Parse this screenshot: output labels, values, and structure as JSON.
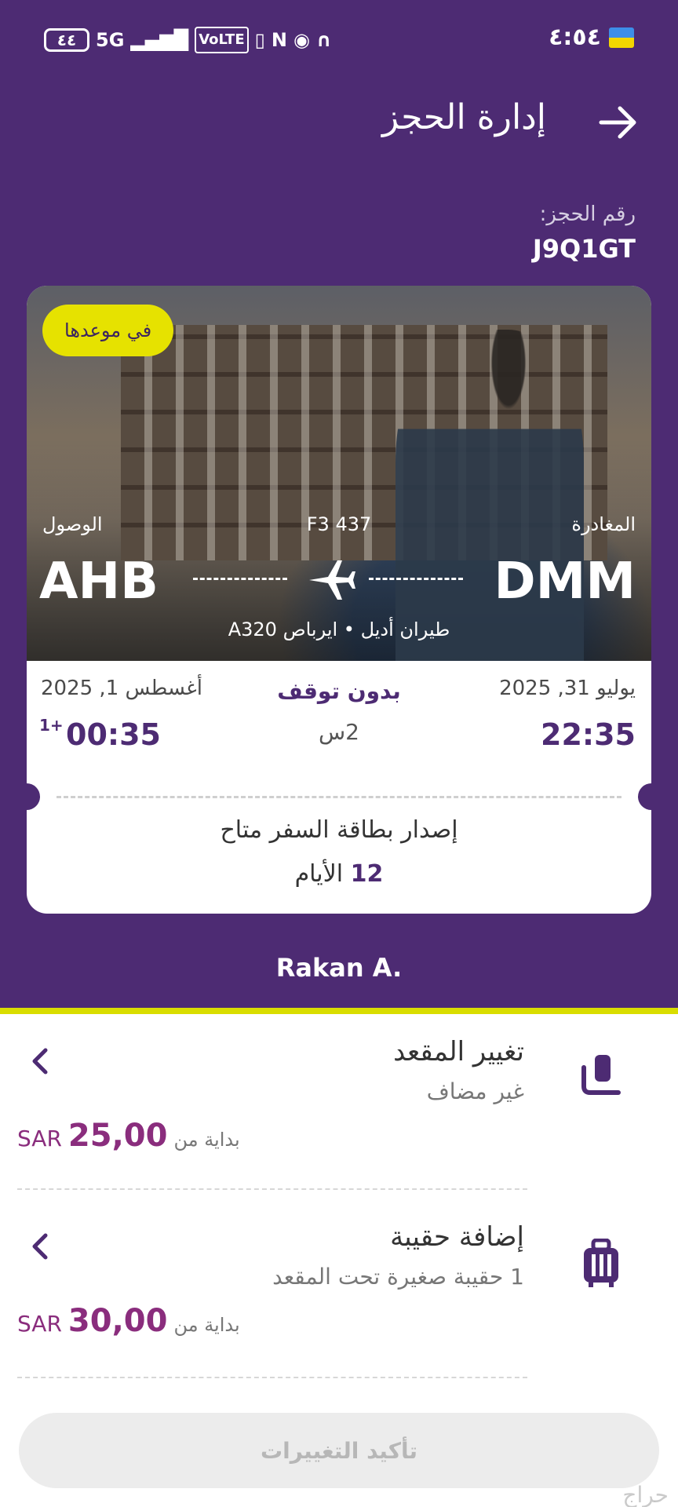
{
  "status_bar": {
    "time": "٤:٥٤",
    "battery": "٤٤",
    "network": "5G",
    "volte": "VoLTE",
    "icons": [
      "vibrate-icon",
      "nfc-icon",
      "eye-icon",
      "headphones-icon",
      "flag-icon"
    ]
  },
  "header": {
    "title": "إدارة الحجز",
    "back_icon": "arrow-right-icon"
  },
  "booking": {
    "pnr_label": "رقم الحجز:",
    "pnr": "J9Q1GT"
  },
  "flight": {
    "status_badge": "في موعدها",
    "departure_label": "المغادرة",
    "arrival_label": "الوصول",
    "flight_number": "F3 437",
    "origin": "DMM",
    "destination": "AHB",
    "aircraft": "طيران أديل • ايرباص A320",
    "departure_date": "يوليو 31, 2025",
    "arrival_date": "أغسطس 1, 2025",
    "departure_time": "22:35",
    "arrival_time": "00:35",
    "day_offset": "1+",
    "stops": "بدون توقف",
    "duration": "2س",
    "boarding_pass_text": "إصدار بطاقة السفر متاح",
    "boarding_days_number": "12",
    "boarding_days_unit": "الأيام"
  },
  "passenger": "Rakan A.",
  "options": [
    {
      "title": "تغيير المقعد",
      "subtitle": "غير مضاف",
      "from_label": "بداية من",
      "price": "25,00",
      "currency": "SAR",
      "icon": "seat-icon"
    },
    {
      "title": "إضافة حقيبة",
      "subtitle": "1 حقيبة صغيرة تحت المقعد",
      "from_label": "بداية من",
      "price": "30,00",
      "currency": "SAR",
      "icon": "luggage-icon"
    }
  ],
  "confirm_button": "تأكيد التغييرات",
  "watermark": "حراج",
  "colors": {
    "primary": "#4d2b73",
    "accent_yellow": "#e6e200",
    "price": "#8a2d7d"
  }
}
